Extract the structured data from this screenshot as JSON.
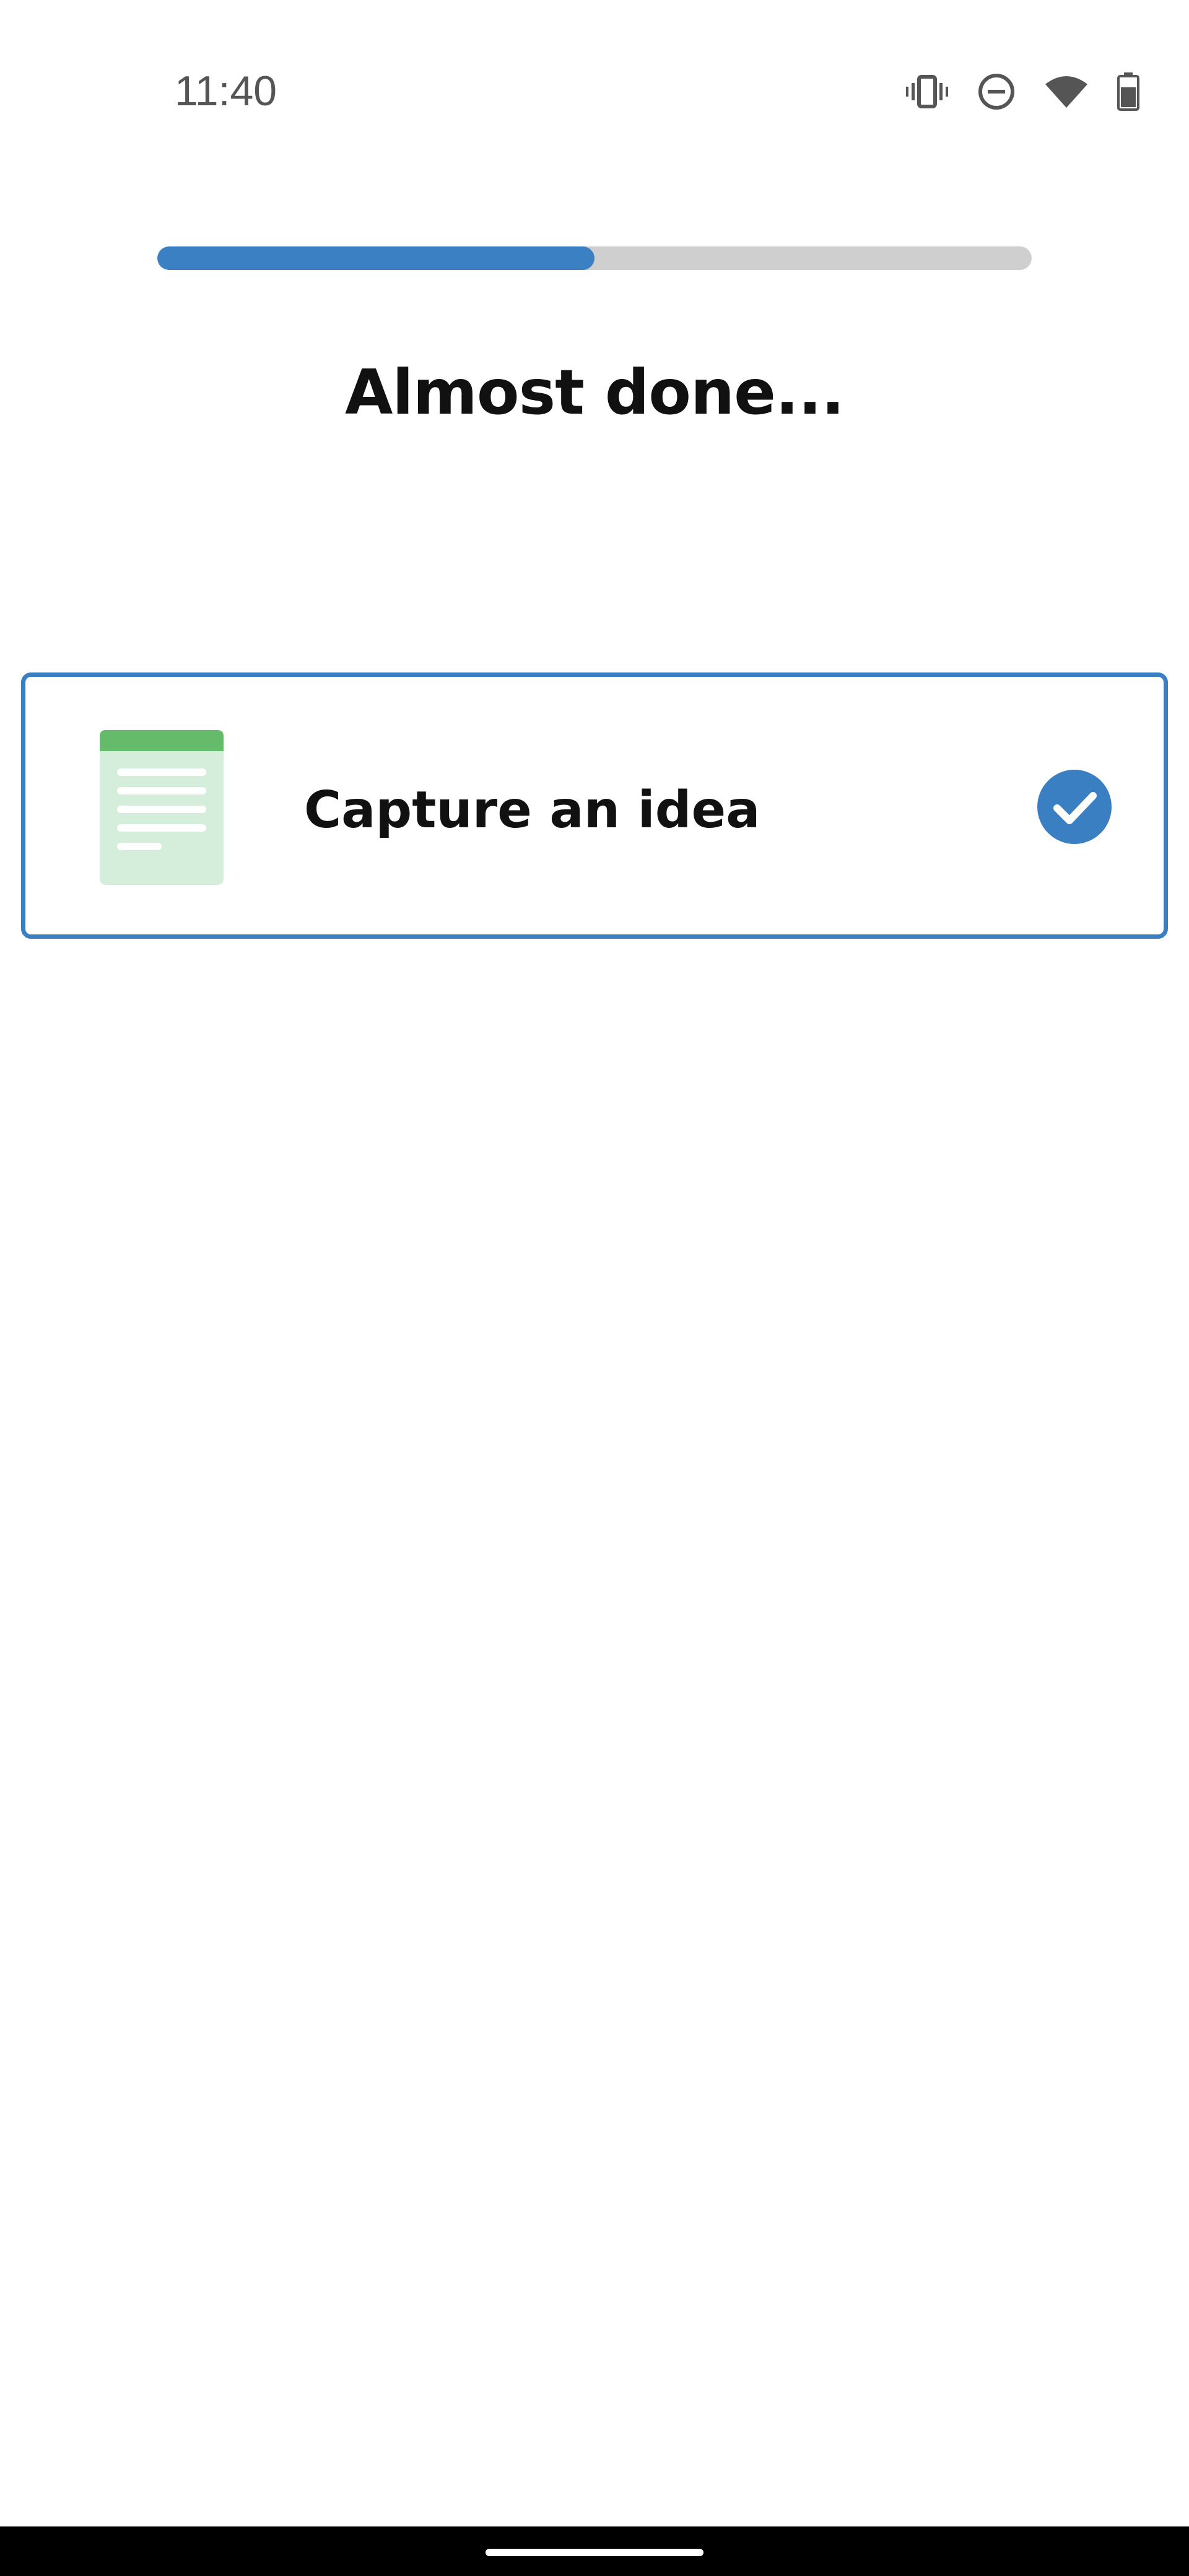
{
  "status_bar": {
    "time": "11:40",
    "icons": [
      "vibrate-icon",
      "do-not-disturb-icon",
      "wifi-icon",
      "battery-icon"
    ]
  },
  "progress": {
    "value": 0.5
  },
  "title": "Almost done...",
  "option": {
    "label": "Capture an idea",
    "icon": "note-document-icon",
    "selected": true,
    "check_icon": "check-circle-icon"
  },
  "colors": {
    "accent": "#3a80c3",
    "track": "#cfcfcf",
    "note_green": "#66bb6a",
    "note_light": "#d5eedc"
  }
}
